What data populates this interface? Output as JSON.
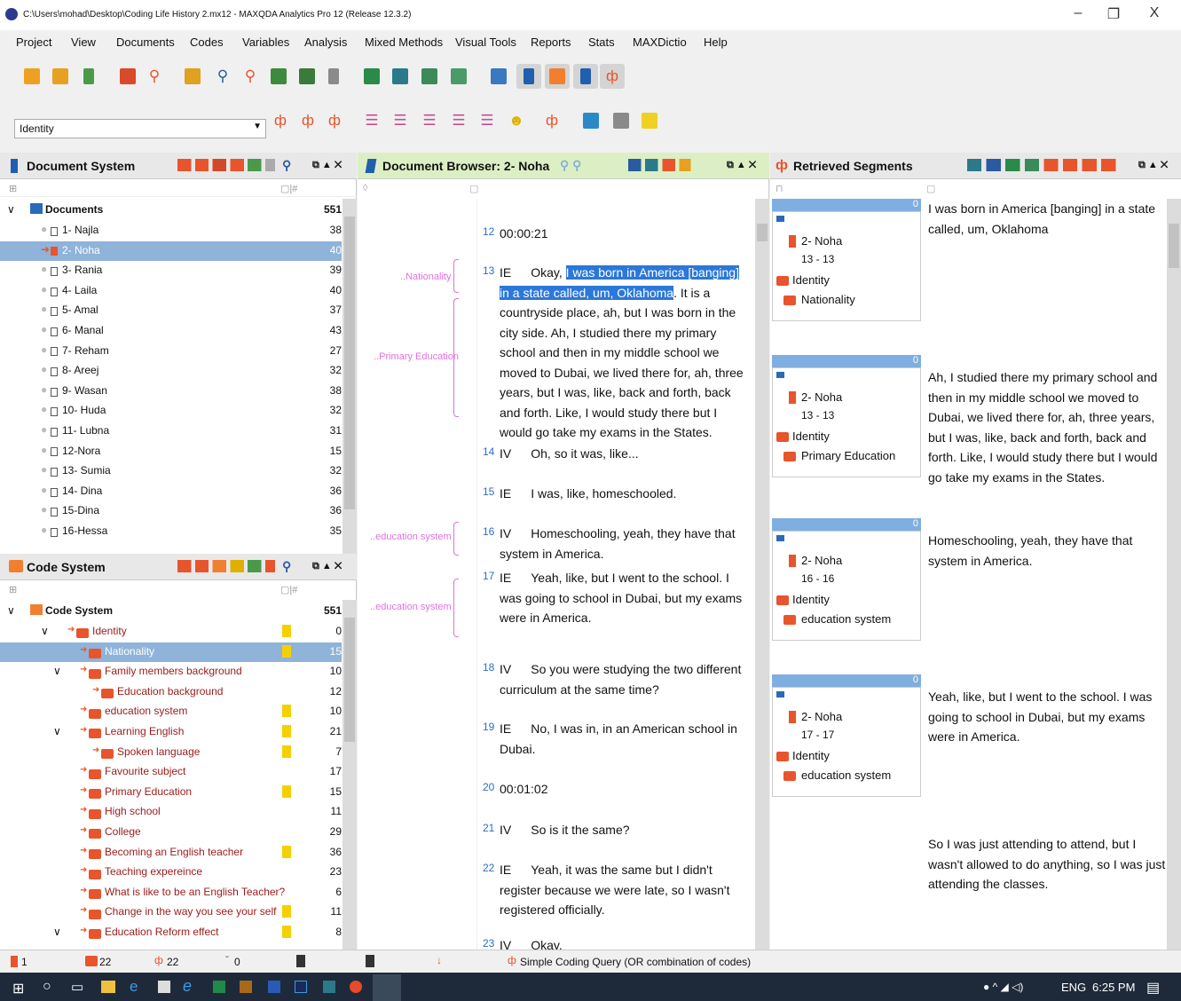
{
  "window": {
    "title": "C:\\Users\\mohad\\Desktop\\Coding Life History 2.mx12 - MAXQDA Analytics Pro 12  (Release 12.3.2)",
    "minimize": "–",
    "maximize": "❐",
    "close": "X"
  },
  "menu": [
    "Project",
    "View",
    "Documents",
    "Codes",
    "Variables",
    "Analysis",
    "Mixed Methods",
    "Visual Tools",
    "Reports",
    "Stats",
    "MAXDictio",
    "Help"
  ],
  "code_dropdown": {
    "value": "Identity"
  },
  "document_system": {
    "title": "Document System",
    "root": {
      "label": "Documents",
      "count": "551"
    },
    "items": [
      {
        "label": "1- Najla",
        "count": "38"
      },
      {
        "label": "2- Noha",
        "count": "40"
      },
      {
        "label": "3- Rania",
        "count": "39"
      },
      {
        "label": "4- Laila",
        "count": "40"
      },
      {
        "label": "5- Amal",
        "count": "37"
      },
      {
        "label": "6- Manal",
        "count": "43"
      },
      {
        "label": "7- Reham",
        "count": "27"
      },
      {
        "label": "8- Areej",
        "count": "32"
      },
      {
        "label": "9- Wasan",
        "count": "38"
      },
      {
        "label": "10- Huda",
        "count": "32"
      },
      {
        "label": "11- Lubna",
        "count": "31"
      },
      {
        "label": "12-Nora",
        "count": "15"
      },
      {
        "label": "13- Sumia",
        "count": "32"
      },
      {
        "label": "14- Dina",
        "count": "36"
      },
      {
        "label": "15-Dina",
        "count": "36"
      },
      {
        "label": "16-Hessa",
        "count": "35"
      }
    ]
  },
  "code_system": {
    "title": "Code System",
    "root": {
      "label": "Code System",
      "count": "551"
    },
    "items": [
      {
        "label": "Identity",
        "count": "0",
        "indent": 1,
        "expander": "∨",
        "color": "#e8542c"
      },
      {
        "label": "Nationality",
        "count": "15",
        "indent": 2,
        "expander": "",
        "color": "#e8542c"
      },
      {
        "label": "Family members background",
        "count": "10",
        "indent": 2,
        "expander": "∨",
        "color": "#e8542c"
      },
      {
        "label": "Education background",
        "count": "12",
        "indent": 3,
        "expander": "",
        "color": "#e8542c"
      },
      {
        "label": "education system",
        "count": "10",
        "indent": 2,
        "expander": "",
        "color": "#e8542c"
      },
      {
        "label": "Learning English",
        "count": "21",
        "indent": 2,
        "expander": "∨",
        "color": "#e8542c"
      },
      {
        "label": "Spoken language",
        "count": "7",
        "indent": 3,
        "expander": "",
        "color": "#e8542c"
      },
      {
        "label": "Favourite subject",
        "count": "17",
        "indent": 2,
        "expander": "",
        "color": "#e8542c"
      },
      {
        "label": "Primary Education",
        "count": "15",
        "indent": 2,
        "expander": "",
        "color": "#e8542c"
      },
      {
        "label": "High school",
        "count": "11",
        "indent": 2,
        "expander": "",
        "color": "#e8542c"
      },
      {
        "label": "College",
        "count": "29",
        "indent": 2,
        "expander": "",
        "color": "#e8542c"
      },
      {
        "label": "Becoming an English teacher",
        "count": "36",
        "indent": 2,
        "expander": "",
        "color": "#e8542c"
      },
      {
        "label": "Teaching expereince",
        "count": "23",
        "indent": 2,
        "expander": "",
        "color": "#e8542c"
      },
      {
        "label": "What is like to be an English Teacher?",
        "count": "6",
        "indent": 2,
        "expander": "",
        "color": "#e8542c"
      },
      {
        "label": "Change in the way you see your self",
        "count": "11",
        "indent": 2,
        "expander": "",
        "color": "#e8542c"
      },
      {
        "label": "Education Reform effect",
        "count": "8",
        "indent": 2,
        "expander": "∨",
        "color": "#e8542c"
      }
    ]
  },
  "document_browser": {
    "title": "Document Browser: 2- Noha",
    "margin_codes": [
      "..Nationality",
      "..Primary Education",
      "..education system",
      "..education system"
    ],
    "paragraphs": [
      {
        "num": "12",
        "speaker": "00:00:21",
        "text": ""
      },
      {
        "num": "13",
        "speaker": "IE",
        "pre": "Okay, ",
        "highlight": "I was born in America [banging] in a state called, um, Oklahoma",
        "text": ".  It is a countryside place, ah, but I was born in the city side.  Ah, I studied there my primary school and then in my middle school we moved to Dubai, we lived there for, ah, three years, but I was, like, back and forth, back and forth.  Like, I would study there but I would go take my exams in the States."
      },
      {
        "num": "14",
        "speaker": "IV",
        "text": "Oh, so it was, like..."
      },
      {
        "num": "15",
        "speaker": "IE",
        "text": "I was, like, homeschooled."
      },
      {
        "num": "16",
        "speaker": "IV",
        "text": "Homeschooling, yeah, they have that system in America."
      },
      {
        "num": "17",
        "speaker": "IE",
        "text": "Yeah, like, but I went to the school.  I was going to school in Dubai, but my exams were in America."
      },
      {
        "num": "18",
        "speaker": "IV",
        "text": "So you were studying the two different curriculum at the same time?"
      },
      {
        "num": "19",
        "speaker": "IE",
        "text": "No, I was in, in an American school in Dubai."
      },
      {
        "num": "20",
        "speaker": "00:01:02",
        "text": ""
      },
      {
        "num": "21",
        "speaker": "IV",
        "text": "So is it the same?"
      },
      {
        "num": "22",
        "speaker": "IE",
        "text": "Yeah, it was the same but I didn't register because we were late, so I wasn't registered officially."
      },
      {
        "num": "23",
        "speaker": "IV",
        "text": "Okay."
      }
    ]
  },
  "retrieved_segments": {
    "title": "Retrieved Segments",
    "segments": [
      {
        "weight": "0",
        "doc": "2- Noha",
        "range": "13 - 13",
        "code1": "Identity",
        "code2": "Nationality",
        "text": "I was born in America [banging] in a state called, um, Oklahoma"
      },
      {
        "weight": "0",
        "doc": "2- Noha",
        "range": "13 - 13",
        "code1": "Identity",
        "code2": "Primary Education",
        "text": "Ah, I studied there my primary school and then in my middle school we moved to Dubai, we lived there for, ah, three years, but I was, like, back and forth, back and forth.  Like, I would study there but I would go take my exams in the States."
      },
      {
        "weight": "0",
        "doc": "2- Noha",
        "range": "16 - 16",
        "code1": "Identity",
        "code2": "education system",
        "text": "Homeschooling, yeah, they have that system in America."
      },
      {
        "weight": "0",
        "doc": "2- Noha",
        "range": "17 - 17",
        "code1": "Identity",
        "code2": "education system",
        "text": "Yeah, like, but I went to the school.  I was going to school in Dubai, but my exams were in America."
      },
      {
        "weight": "",
        "doc": "",
        "range": "",
        "code1": "",
        "code2": "",
        "text": "So I was just attending to attend, but I wasn't allowed to do anything, so I was just attending the classes."
      }
    ]
  },
  "statusbar": {
    "docs": "1",
    "codes": "22",
    "segments": "22",
    "memos": "0",
    "query": "Simple Coding Query (OR combination of codes)"
  },
  "taskbar": {
    "lang": "ENG",
    "time": "6:25 PM"
  }
}
